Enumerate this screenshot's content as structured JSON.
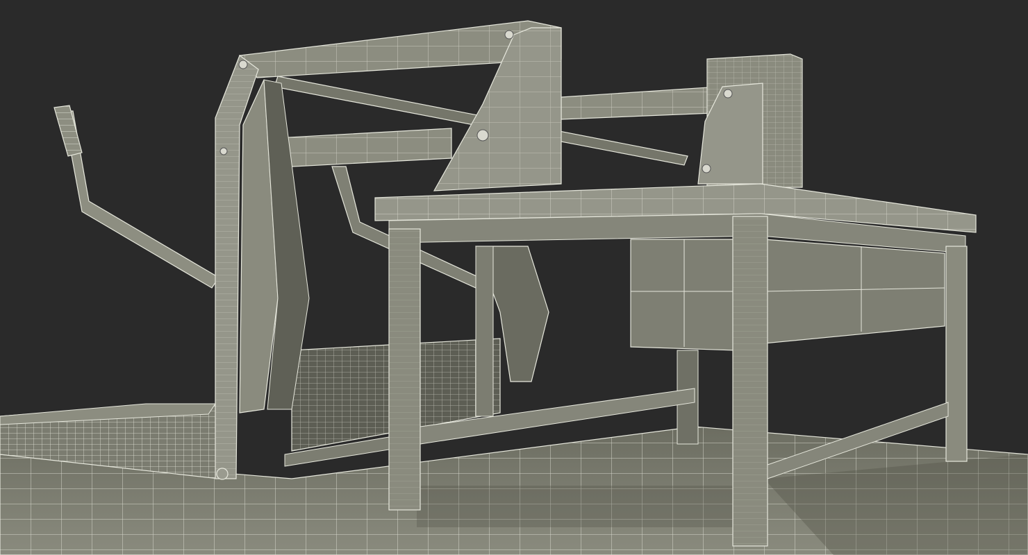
{
  "scene": {
    "background_color": "#2a2a2a",
    "surface_color": "#7e7f72",
    "shadow_color": "#55564b",
    "wire_color": "#e8e9e0"
  }
}
